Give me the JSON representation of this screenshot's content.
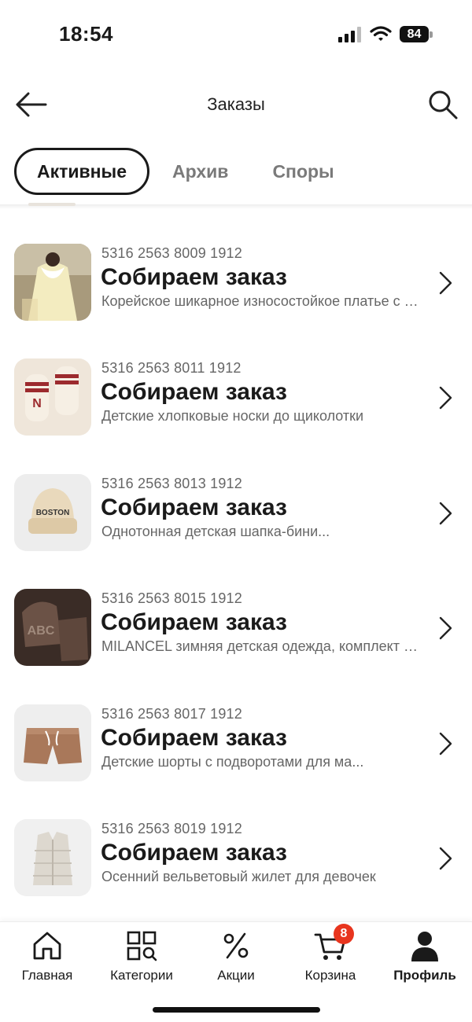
{
  "status_bar": {
    "time": "18:54",
    "battery": "84"
  },
  "header": {
    "title": "Заказы"
  },
  "tabs": [
    {
      "label": "Активные",
      "active": true
    },
    {
      "label": "Архив",
      "active": false
    },
    {
      "label": "Споры",
      "active": false
    }
  ],
  "orders": [
    {
      "number": "5316 2563 8009 1912",
      "status": "Собираем заказ",
      "description": "Корейское шикарное износостойкое платье с длинными рукавами"
    },
    {
      "number": "5316 2563 8011 1912",
      "status": "Собираем заказ",
      "description": "Детские хлопковые носки до щиколотки"
    },
    {
      "number": "5316 2563 8013 1912",
      "status": "Собираем заказ",
      "description": "Однотонная детская шапка-бини..."
    },
    {
      "number": "5316 2563 8015 1912",
      "status": "Собираем заказ",
      "description": "MILANCEL зимняя детская одежда, комплект толстовка и брюки"
    },
    {
      "number": "5316 2563 8017 1912",
      "status": "Собираем заказ",
      "description": "Детские шорты с подворотами для ма..."
    },
    {
      "number": "5316 2563 8019 1912",
      "status": "Собираем заказ",
      "description": "Осенний вельветовый жилет для девочек"
    }
  ],
  "bottom_nav": {
    "home": "Главная",
    "categories": "Категории",
    "promos": "Акции",
    "cart": "Корзина",
    "cart_badge": "8",
    "profile": "Профиль"
  },
  "colors": {
    "accent_badge": "#e8351e",
    "text_primary": "#1a1a1a",
    "text_secondary": "#666666"
  }
}
